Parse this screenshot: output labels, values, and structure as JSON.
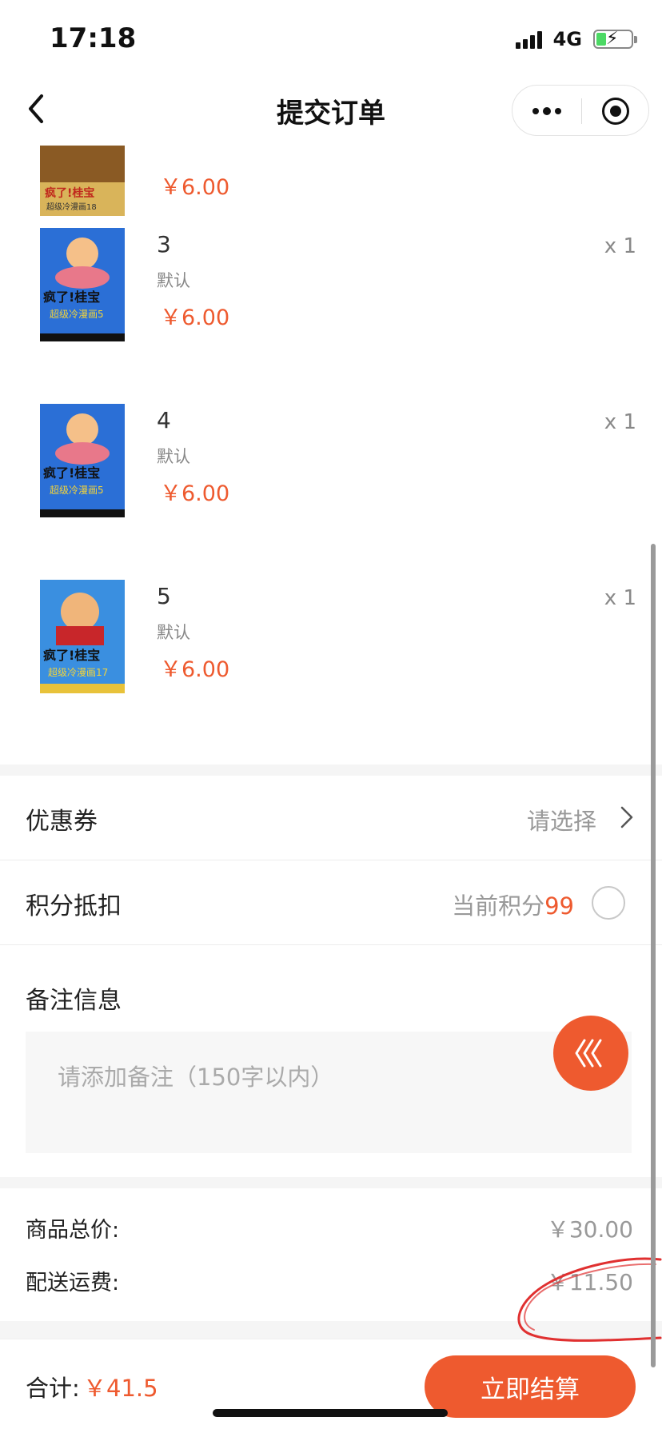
{
  "status_bar": {
    "time": "17:18",
    "network": "4G"
  },
  "nav": {
    "title": "提交订单",
    "more_icon": "more-dots-icon",
    "close_icon": "target-close-icon",
    "back_icon": "chevron-left-icon"
  },
  "goods": [
    {
      "name": "",
      "spec": "",
      "price": "￥6.00",
      "qty": "",
      "cover": "book-cover-18"
    },
    {
      "name": "3",
      "spec": "默认",
      "price": "￥6.00",
      "qty": "x 1",
      "cover": "book-cover-5"
    },
    {
      "name": "4",
      "spec": "默认",
      "price": "￥6.00",
      "qty": "x 1",
      "cover": "book-cover-5"
    },
    {
      "name": "5",
      "spec": "默认",
      "price": "￥6.00",
      "qty": "x 1",
      "cover": "book-cover-17"
    }
  ],
  "coupon": {
    "label": "优惠券",
    "value": "请选择"
  },
  "points": {
    "label": "积分抵扣",
    "prefix": "当前积分",
    "value": "99"
  },
  "remark": {
    "label": "备注信息",
    "placeholder": "请添加备注（150字以内）"
  },
  "summary": {
    "goods_total_label": "商品总价:",
    "goods_total": "￥30.00",
    "shipping_label": "配送运费:",
    "shipping": "￥11.50"
  },
  "footer": {
    "total_label": "合计:",
    "total_value": "￥41.5",
    "checkout_label": "立即结算"
  },
  "colors": {
    "accent": "#ee5a2f",
    "annotation": "#e03030"
  }
}
